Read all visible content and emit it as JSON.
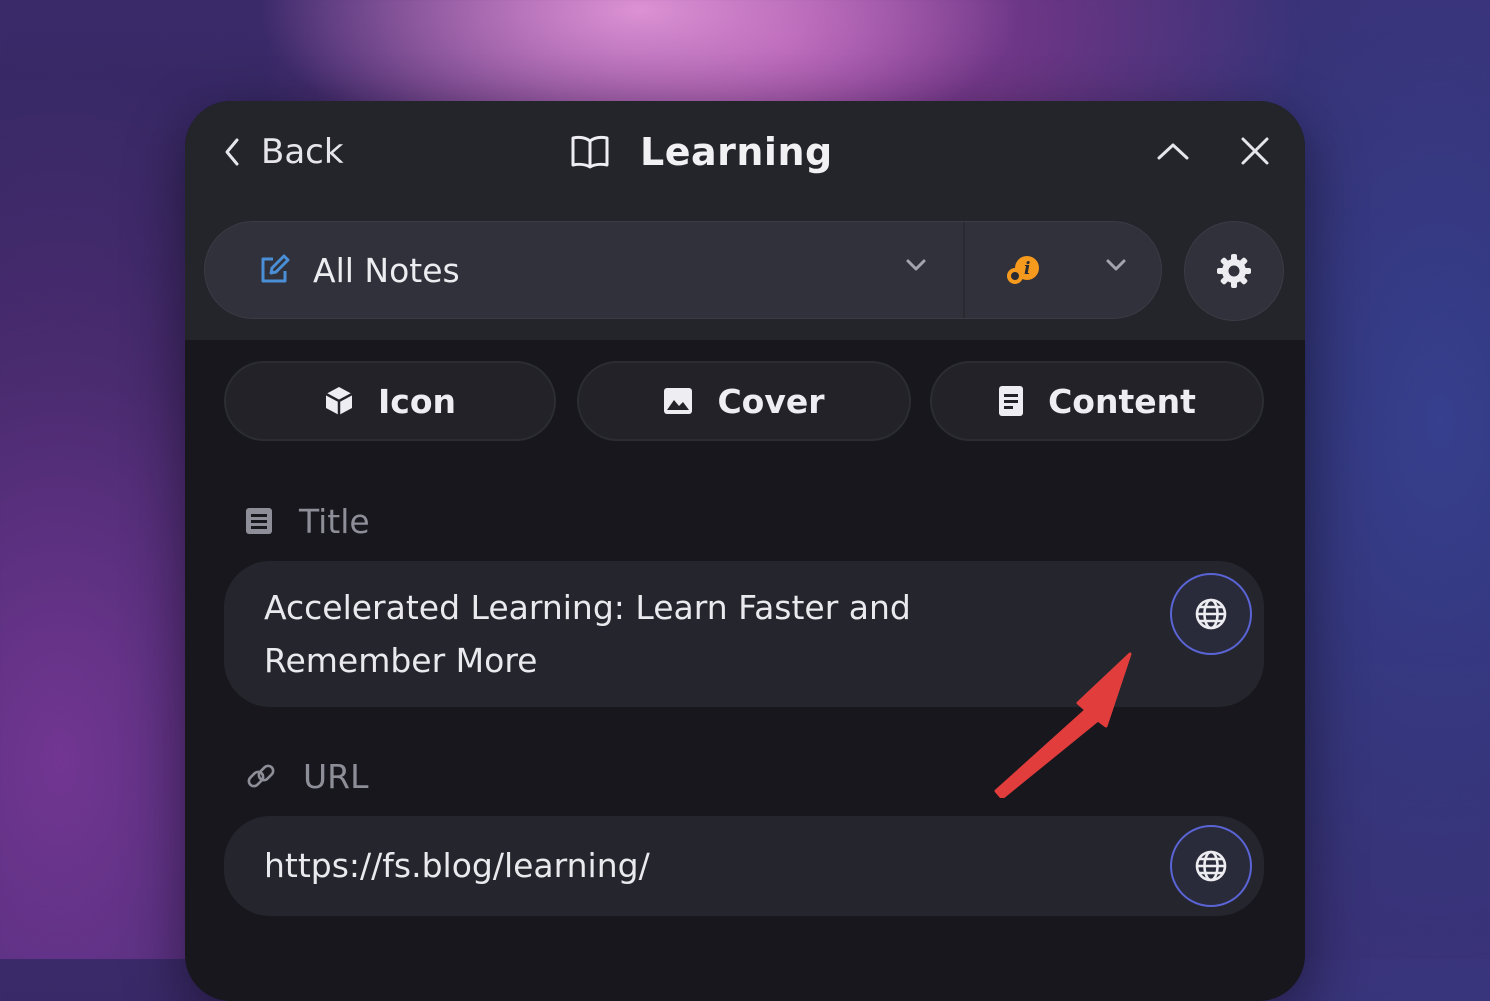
{
  "header": {
    "back_label": "Back",
    "title": "Learning"
  },
  "selector": {
    "notes_label": "All Notes"
  },
  "tabs": [
    {
      "label": "Icon",
      "icon": "cube-icon"
    },
    {
      "label": "Cover",
      "icon": "image-icon"
    },
    {
      "label": "Content",
      "icon": "document-icon"
    }
  ],
  "fields": {
    "title": {
      "label": "Title",
      "value_line1": "Accelerated Learning: Learn Faster and",
      "value_line2": "Remember More"
    },
    "url": {
      "label": "URL",
      "value": "https://fs.blog/learning/"
    }
  },
  "colors": {
    "panel": "#17171d",
    "header": "#24242b",
    "accent_blue": "#5a64d6",
    "edit_icon": "#4a8fd6",
    "badge_orange": "#f59a1c",
    "annotation_arrow": "#e23d3d"
  }
}
